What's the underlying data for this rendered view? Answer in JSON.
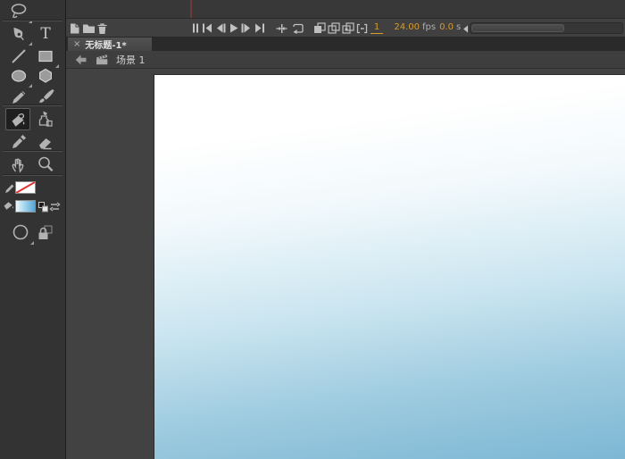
{
  "document_tab": {
    "close_glyph": "×",
    "title": "无标题-1*"
  },
  "edit_bar": {
    "scene_name": "场景 1"
  },
  "timeline_controls": {
    "current_frame": "1",
    "frame_rate": "24.00",
    "frame_rate_unit": "fps",
    "elapsed_time": "0.0",
    "elapsed_time_unit": "s",
    "icon_names": [
      "new-layer",
      "new-folder",
      "delete",
      "pause",
      "first-frame",
      "step-back",
      "play",
      "step-forward",
      "last-frame",
      "center-frame",
      "loop-playback",
      "onion-skin",
      "onion-skin-outlines",
      "edit-multiple-frames",
      "modify-markers",
      "collapse-panel",
      "horizontal-scrollbar"
    ]
  },
  "tool_panel": {
    "text_tool_glyph": "T",
    "tool_names": [
      "lasso",
      "pen",
      "text",
      "line",
      "rectangle",
      "oval",
      "polystar",
      "pencil",
      "brush",
      "paint-bucket",
      "ink-bottle",
      "eyedropper",
      "eraser",
      "hand",
      "zoom"
    ],
    "selected_tool": "paint-bucket",
    "stroke_color": "none",
    "fill_color": "white-to-blue-gradient",
    "option_names": [
      "gap-size",
      "lock-fill"
    ]
  },
  "colors": {
    "accent_orange": "#d79b28",
    "playhead_red": "#6e3939",
    "stage_gradient_top": "#ffffff",
    "stage_gradient_bottom": "#7db7d4",
    "fill_swatch_blue": "#56a6d5",
    "stroke_none_slash": "#e03030"
  }
}
